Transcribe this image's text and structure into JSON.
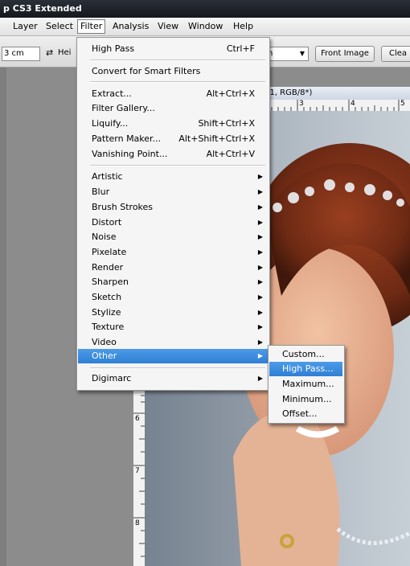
{
  "window": {
    "title": "p CS3 Extended"
  },
  "menubar": {
    "items": [
      {
        "label": "Layer"
      },
      {
        "label": "Select"
      },
      {
        "label": "Filter"
      },
      {
        "label": "Analysis"
      },
      {
        "label": "View"
      },
      {
        "label": "Window"
      },
      {
        "label": "Help"
      }
    ]
  },
  "options": {
    "width_value": "3 cm",
    "height_label": "Hei",
    "resolution_unit": "h",
    "front_image_label": "Front Image",
    "clear_label": "Clea"
  },
  "document": {
    "title": "er 1, RGB/8*)",
    "hruler_labels": [
      "3",
      "4",
      "5"
    ],
    "vruler_labels": [
      "6",
      "7",
      "8"
    ]
  },
  "filter_menu": {
    "last_filter": {
      "label": "High Pass",
      "shortcut": "Ctrl+F"
    },
    "convert": {
      "label": "Convert for Smart Filters"
    },
    "special": [
      {
        "label": "Extract...",
        "shortcut": "Alt+Ctrl+X"
      },
      {
        "label": "Filter Gallery...",
        "shortcut": ""
      },
      {
        "label": "Liquify...",
        "shortcut": "Shift+Ctrl+X"
      },
      {
        "label": "Pattern Maker...",
        "shortcut": "Alt+Shift+Ctrl+X"
      },
      {
        "label": "Vanishing Point...",
        "shortcut": "Alt+Ctrl+V"
      }
    ],
    "groups": [
      {
        "label": "Artistic"
      },
      {
        "label": "Blur"
      },
      {
        "label": "Brush Strokes"
      },
      {
        "label": "Distort"
      },
      {
        "label": "Noise"
      },
      {
        "label": "Pixelate"
      },
      {
        "label": "Render"
      },
      {
        "label": "Sharpen"
      },
      {
        "label": "Sketch"
      },
      {
        "label": "Stylize"
      },
      {
        "label": "Texture"
      },
      {
        "label": "Video"
      },
      {
        "label": "Other"
      }
    ],
    "digimarc": {
      "label": "Digimarc"
    }
  },
  "other_submenu": {
    "items": [
      {
        "label": "Custom..."
      },
      {
        "label": "High Pass..."
      },
      {
        "label": "Maximum..."
      },
      {
        "label": "Minimum..."
      },
      {
        "label": "Offset..."
      }
    ]
  },
  "colors": {
    "highlight": "#3a8ae0",
    "menu_bg": "#f5f5f5",
    "titlebar": "#1c1f25"
  }
}
